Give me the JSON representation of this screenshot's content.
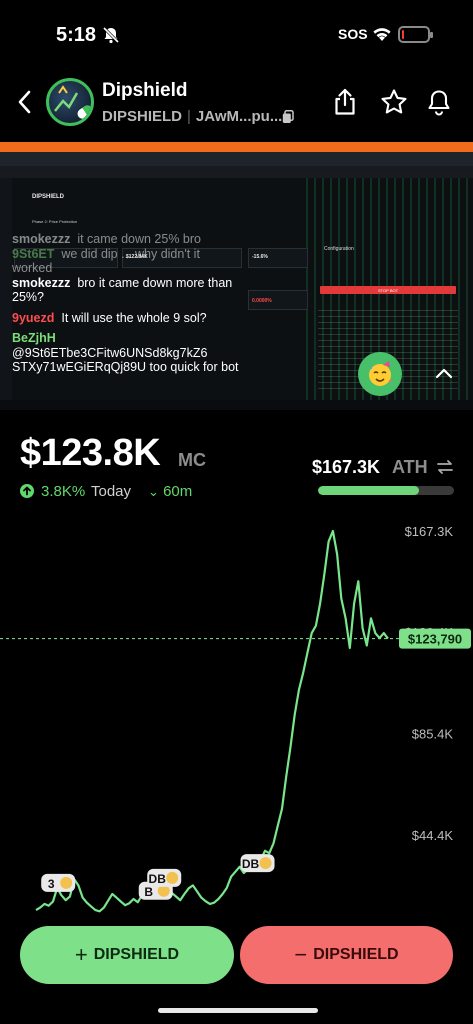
{
  "status_bar": {
    "time": "5:18",
    "sos": "SOS",
    "battery_level_pct": 10
  },
  "header": {
    "name": "Dipshield",
    "ticker": "DIPSHIELD",
    "address_short": "JAwM...pu..."
  },
  "stream": {
    "chat": [
      {
        "user": "smokezzz",
        "text": "it came down 25% bro",
        "user_color": "white",
        "faded": true
      },
      {
        "user": "9St6ET",
        "text": "we did dip ... why didn't it worked",
        "user_color": "green",
        "faded": true
      },
      {
        "user": "smokezzz",
        "text": "bro it came down more than 25%?",
        "user_color": "white",
        "faded": false
      },
      {
        "user": "9yuezd",
        "text": "It will use the whole 9 sol?",
        "user_color": "red",
        "faded": false
      },
      {
        "user": "BeZjhH",
        "text": "@9St6ETbe3CFitw6UNSd8kg7kZ6 STXy71wEGiERqQj89U too quick for bot",
        "user_color": "green",
        "faded": false
      }
    ],
    "screen_text": {
      "logo": "DIPSHIELD",
      "phase": "Phase 2: Price Protection",
      "price": "$122.84K",
      "drawdown": "-15.6%",
      "supply_red": "0.0000%",
      "config": "Configuration",
      "red_button": "STOP BOT"
    }
  },
  "market": {
    "mc_value": "$123.8K",
    "mc_unit": "MC",
    "change_pct": "3.8K%",
    "change_period": "Today",
    "time_label": "60m",
    "ath_value": "$167.3K",
    "ath_unit": "ATH",
    "ath_progress": 0.74
  },
  "chart_data": {
    "type": "line",
    "y_ticks": [
      "$167.3K",
      "$126.4K",
      "$85.4K",
      "$44.4K"
    ],
    "y_tick_values": [
      167300,
      126400,
      85400,
      44400
    ],
    "current_value": 123790,
    "current_label": "$123,790",
    "ylim": [
      10000,
      167300
    ],
    "line_color": "#79e58c",
    "values": [
      14000,
      15000,
      16500,
      15800,
      17500,
      23000,
      20000,
      18000,
      19500,
      26500,
      24000,
      19000,
      17000,
      15500,
      14000,
      13500,
      15000,
      17800,
      20500,
      19000,
      17500,
      16000,
      16800,
      18500,
      17200,
      20000,
      22500,
      21000,
      19800,
      24500,
      25000,
      23000,
      21000,
      19500,
      18000,
      20500,
      22800,
      24000,
      21500,
      19000,
      17600,
      16500,
      17000,
      18500,
      20500,
      23000,
      27500,
      29500,
      31500,
      29000,
      30500,
      32500,
      31000,
      34500,
      38000,
      37000,
      41000,
      48000,
      55000,
      68000,
      80000,
      93000,
      103000,
      110000,
      118000,
      126000,
      129000,
      138000,
      150000,
      163000,
      167300,
      158000,
      140000,
      132000,
      120000,
      138000,
      147000,
      128000,
      121000,
      132000,
      126000,
      124000,
      126000,
      123790
    ],
    "markers": [
      {
        "label": "3",
        "index": 5
      },
      {
        "label": "B",
        "index": 28
      },
      {
        "label": "DB",
        "index": 30
      },
      {
        "label": "DB",
        "index": 52
      }
    ]
  },
  "actions": {
    "buy_label": "DIPSHIELD",
    "sell_label": "DIPSHIELD"
  }
}
